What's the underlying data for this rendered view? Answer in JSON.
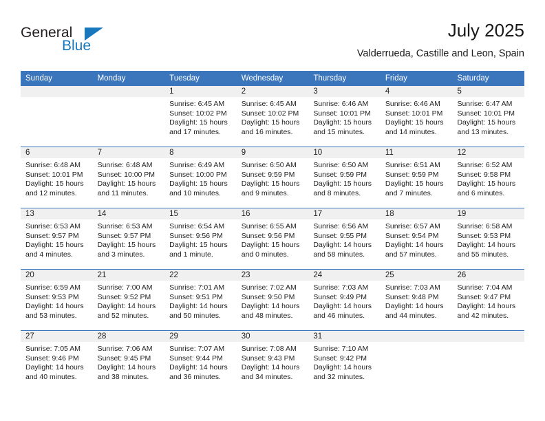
{
  "brand": {
    "word1": "General",
    "word2": "Blue",
    "accent_color": "#1878be"
  },
  "header": {
    "title": "July 2025",
    "location": "Valderrueda, Castille and Leon, Spain"
  },
  "calendar": {
    "header_bg": "#3b76bd",
    "daynum_bg": "#f0f0f0",
    "weekdays": [
      "Sunday",
      "Monday",
      "Tuesday",
      "Wednesday",
      "Thursday",
      "Friday",
      "Saturday"
    ],
    "labels": {
      "sunrise": "Sunrise:",
      "sunset": "Sunset:",
      "daylight": "Daylight:"
    },
    "weeks": [
      [
        {
          "day": ""
        },
        {
          "day": ""
        },
        {
          "day": "1",
          "sunrise": "Sunrise: 6:45 AM",
          "sunset": "Sunset: 10:02 PM",
          "daylight": "Daylight: 15 hours and 17 minutes."
        },
        {
          "day": "2",
          "sunrise": "Sunrise: 6:45 AM",
          "sunset": "Sunset: 10:02 PM",
          "daylight": "Daylight: 15 hours and 16 minutes."
        },
        {
          "day": "3",
          "sunrise": "Sunrise: 6:46 AM",
          "sunset": "Sunset: 10:01 PM",
          "daylight": "Daylight: 15 hours and 15 minutes."
        },
        {
          "day": "4",
          "sunrise": "Sunrise: 6:46 AM",
          "sunset": "Sunset: 10:01 PM",
          "daylight": "Daylight: 15 hours and 14 minutes."
        },
        {
          "day": "5",
          "sunrise": "Sunrise: 6:47 AM",
          "sunset": "Sunset: 10:01 PM",
          "daylight": "Daylight: 15 hours and 13 minutes."
        }
      ],
      [
        {
          "day": "6",
          "sunrise": "Sunrise: 6:48 AM",
          "sunset": "Sunset: 10:01 PM",
          "daylight": "Daylight: 15 hours and 12 minutes."
        },
        {
          "day": "7",
          "sunrise": "Sunrise: 6:48 AM",
          "sunset": "Sunset: 10:00 PM",
          "daylight": "Daylight: 15 hours and 11 minutes."
        },
        {
          "day": "8",
          "sunrise": "Sunrise: 6:49 AM",
          "sunset": "Sunset: 10:00 PM",
          "daylight": "Daylight: 15 hours and 10 minutes."
        },
        {
          "day": "9",
          "sunrise": "Sunrise: 6:50 AM",
          "sunset": "Sunset: 9:59 PM",
          "daylight": "Daylight: 15 hours and 9 minutes."
        },
        {
          "day": "10",
          "sunrise": "Sunrise: 6:50 AM",
          "sunset": "Sunset: 9:59 PM",
          "daylight": "Daylight: 15 hours and 8 minutes."
        },
        {
          "day": "11",
          "sunrise": "Sunrise: 6:51 AM",
          "sunset": "Sunset: 9:59 PM",
          "daylight": "Daylight: 15 hours and 7 minutes."
        },
        {
          "day": "12",
          "sunrise": "Sunrise: 6:52 AM",
          "sunset": "Sunset: 9:58 PM",
          "daylight": "Daylight: 15 hours and 6 minutes."
        }
      ],
      [
        {
          "day": "13",
          "sunrise": "Sunrise: 6:53 AM",
          "sunset": "Sunset: 9:57 PM",
          "daylight": "Daylight: 15 hours and 4 minutes."
        },
        {
          "day": "14",
          "sunrise": "Sunrise: 6:53 AM",
          "sunset": "Sunset: 9:57 PM",
          "daylight": "Daylight: 15 hours and 3 minutes."
        },
        {
          "day": "15",
          "sunrise": "Sunrise: 6:54 AM",
          "sunset": "Sunset: 9:56 PM",
          "daylight": "Daylight: 15 hours and 1 minute."
        },
        {
          "day": "16",
          "sunrise": "Sunrise: 6:55 AM",
          "sunset": "Sunset: 9:56 PM",
          "daylight": "Daylight: 15 hours and 0 minutes."
        },
        {
          "day": "17",
          "sunrise": "Sunrise: 6:56 AM",
          "sunset": "Sunset: 9:55 PM",
          "daylight": "Daylight: 14 hours and 58 minutes."
        },
        {
          "day": "18",
          "sunrise": "Sunrise: 6:57 AM",
          "sunset": "Sunset: 9:54 PM",
          "daylight": "Daylight: 14 hours and 57 minutes."
        },
        {
          "day": "19",
          "sunrise": "Sunrise: 6:58 AM",
          "sunset": "Sunset: 9:53 PM",
          "daylight": "Daylight: 14 hours and 55 minutes."
        }
      ],
      [
        {
          "day": "20",
          "sunrise": "Sunrise: 6:59 AM",
          "sunset": "Sunset: 9:53 PM",
          "daylight": "Daylight: 14 hours and 53 minutes."
        },
        {
          "day": "21",
          "sunrise": "Sunrise: 7:00 AM",
          "sunset": "Sunset: 9:52 PM",
          "daylight": "Daylight: 14 hours and 52 minutes."
        },
        {
          "day": "22",
          "sunrise": "Sunrise: 7:01 AM",
          "sunset": "Sunset: 9:51 PM",
          "daylight": "Daylight: 14 hours and 50 minutes."
        },
        {
          "day": "23",
          "sunrise": "Sunrise: 7:02 AM",
          "sunset": "Sunset: 9:50 PM",
          "daylight": "Daylight: 14 hours and 48 minutes."
        },
        {
          "day": "24",
          "sunrise": "Sunrise: 7:03 AM",
          "sunset": "Sunset: 9:49 PM",
          "daylight": "Daylight: 14 hours and 46 minutes."
        },
        {
          "day": "25",
          "sunrise": "Sunrise: 7:03 AM",
          "sunset": "Sunset: 9:48 PM",
          "daylight": "Daylight: 14 hours and 44 minutes."
        },
        {
          "day": "26",
          "sunrise": "Sunrise: 7:04 AM",
          "sunset": "Sunset: 9:47 PM",
          "daylight": "Daylight: 14 hours and 42 minutes."
        }
      ],
      [
        {
          "day": "27",
          "sunrise": "Sunrise: 7:05 AM",
          "sunset": "Sunset: 9:46 PM",
          "daylight": "Daylight: 14 hours and 40 minutes."
        },
        {
          "day": "28",
          "sunrise": "Sunrise: 7:06 AM",
          "sunset": "Sunset: 9:45 PM",
          "daylight": "Daylight: 14 hours and 38 minutes."
        },
        {
          "day": "29",
          "sunrise": "Sunrise: 7:07 AM",
          "sunset": "Sunset: 9:44 PM",
          "daylight": "Daylight: 14 hours and 36 minutes."
        },
        {
          "day": "30",
          "sunrise": "Sunrise: 7:08 AM",
          "sunset": "Sunset: 9:43 PM",
          "daylight": "Daylight: 14 hours and 34 minutes."
        },
        {
          "day": "31",
          "sunrise": "Sunrise: 7:10 AM",
          "sunset": "Sunset: 9:42 PM",
          "daylight": "Daylight: 14 hours and 32 minutes."
        },
        {
          "day": ""
        },
        {
          "day": ""
        }
      ]
    ]
  }
}
